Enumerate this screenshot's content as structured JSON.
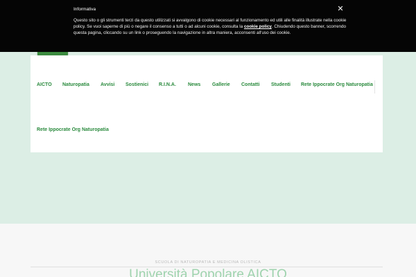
{
  "cookie_banner": {
    "title": "Informativa",
    "text_before_link": "Questo sito o gli strumenti terzi da questo utilizzati si avvalgono di cookie necessari al funzionamento ed utili alle finalità illustrate nella cookie policy. Se vuoi saperne di più o negare il consenso a tutti o ad alcuni cookie, consulta la ",
    "link_label": "cookie policy",
    "text_after_link": ". Chiudendo questo banner, scorrendo questa pagina, cliccando su un link o proseguendo la navigazione in altra maniera, acconsenti all'uso dei cookie.",
    "close_glyph": "✕",
    "close_icon": "close-icon"
  },
  "header": {
    "logo_icon": "site-logo"
  },
  "nav": {
    "items": [
      {
        "label": "AICTO"
      },
      {
        "label": "Naturopatia"
      },
      {
        "label": "Avvisi"
      },
      {
        "label": "Sostienici"
      },
      {
        "label": "R.I.N.A."
      },
      {
        "label": "News"
      },
      {
        "label": "Gallerie"
      },
      {
        "label": "Contatti"
      },
      {
        "label": "Studenti"
      },
      {
        "label": "Rete Ippocrate Org Naturopatia"
      },
      {
        "label": "Rete Ippocrate Org Naturopatia"
      }
    ]
  },
  "school": {
    "tagline": "SCUOLA DI NATUROPATIA E MEDICINA OLISTICA",
    "title": "Università Popolare AICTO"
  },
  "colors": {
    "accent": "#2a8a3d",
    "hero_background": "#dceee5",
    "banner_background": "#050505"
  }
}
